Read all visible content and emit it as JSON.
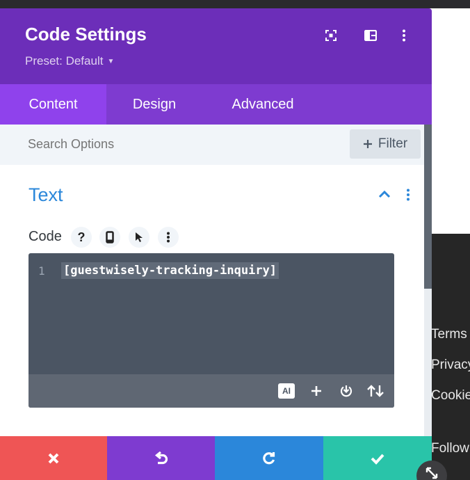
{
  "modal": {
    "title": "Code Settings",
    "preset_label": "Preset: Default",
    "header_icons": [
      "focus-mode-icon",
      "split-view-icon",
      "more-vertical-icon"
    ]
  },
  "tabs": [
    {
      "label": "Content",
      "active": true
    },
    {
      "label": "Design",
      "active": false
    },
    {
      "label": "Advanced",
      "active": false
    }
  ],
  "search": {
    "placeholder": "Search Options",
    "filter_label": "Filter"
  },
  "section": {
    "title": "Text",
    "expanded": true
  },
  "code_field": {
    "label": "Code",
    "help_glyph": "?",
    "line_number": "1",
    "value": "[guestwisely-tracking-inquiry]",
    "ai_label": "AI"
  },
  "footer": {
    "buttons": [
      {
        "icon": "close-icon",
        "color": "#ef5555"
      },
      {
        "icon": "undo-icon",
        "color": "#7e3bd0"
      },
      {
        "icon": "redo-icon",
        "color": "#2b87da"
      },
      {
        "icon": "check-icon",
        "color": "#29c4a9"
      }
    ]
  },
  "background_page": {
    "links": [
      "Terms",
      "Privacy",
      "Cookies",
      "Follow us"
    ]
  },
  "colors": {
    "header": "#6c2eb9",
    "tabs_bar": "#7e3bd0",
    "active_tab": "#8f42ec",
    "accent_blue": "#2b87da",
    "editor_bg": "#4b5563"
  }
}
